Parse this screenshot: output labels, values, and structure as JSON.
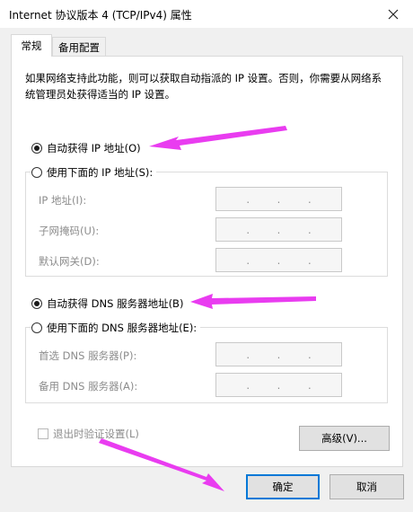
{
  "window": {
    "title": "Internet 协议版本 4 (TCP/IPv4) 属性",
    "close_icon": "close-icon"
  },
  "tabs": [
    {
      "label": "常规",
      "active": true
    },
    {
      "label": "备用配置",
      "active": false
    }
  ],
  "description": "如果网络支持此功能，则可以获取自动指派的 IP 设置。否则，你需要从网络系统管理员处获得适当的 IP 设置。",
  "ip_section": {
    "auto_label": "自动获得 IP 地址(O)",
    "auto_selected": true,
    "manual_label": "使用下面的 IP 地址(S):",
    "fields": [
      {
        "label": "IP 地址(I):",
        "value": ".   .   ."
      },
      {
        "label": "子网掩码(U):",
        "value": ".   .   ."
      },
      {
        "label": "默认网关(D):",
        "value": ".   .   ."
      }
    ]
  },
  "dns_section": {
    "auto_label": "自动获得 DNS 服务器地址(B)",
    "auto_selected": true,
    "manual_label": "使用下面的 DNS 服务器地址(E):",
    "fields": [
      {
        "label": "首选 DNS 服务器(P):",
        "value": ".   .   ."
      },
      {
        "label": "备用 DNS 服务器(A):",
        "value": ".   .   ."
      }
    ]
  },
  "validate_checkbox": {
    "label": "退出时验证设置(L)",
    "checked": false,
    "enabled": false
  },
  "buttons": {
    "advanced": "高级(V)...",
    "ok": "确定",
    "cancel": "取消"
  },
  "annotation_color": "#e93cf0"
}
